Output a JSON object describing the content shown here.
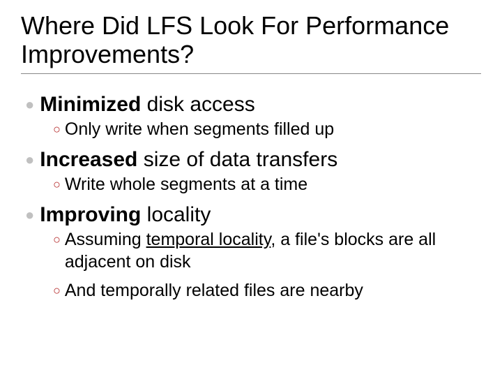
{
  "title": "Where Did LFS Look For Performance Improvements?",
  "points": [
    {
      "bold": "Minimized",
      "rest": " disk access",
      "subs": [
        {
          "text": "Only write when segments filled up"
        }
      ]
    },
    {
      "bold": "Increased",
      "rest": " size of data transfers",
      "subs": [
        {
          "text": "Write whole segments at a time"
        }
      ]
    },
    {
      "bold": "Improving",
      "rest": " locality",
      "subs": [
        {
          "pre": "Assuming ",
          "under": "temporal locality",
          "post": ", a file's blocks are all adjacent on disk"
        },
        {
          "text": "And temporally related files are nearby"
        }
      ]
    }
  ]
}
